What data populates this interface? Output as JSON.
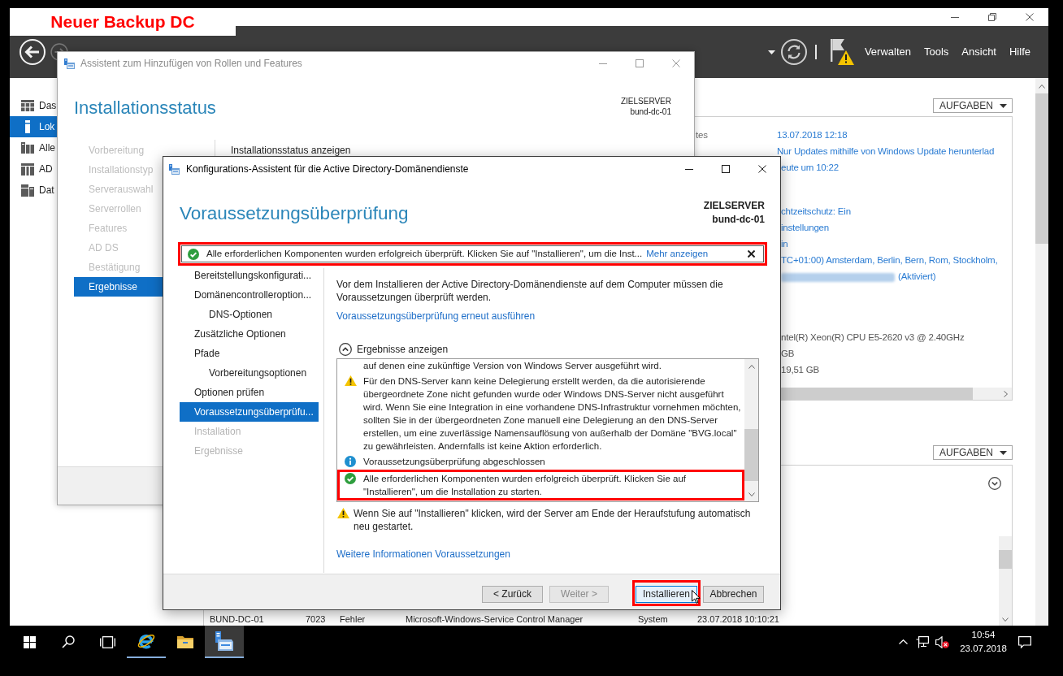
{
  "annotation": {
    "text": "Neuer Backup DC"
  },
  "server_manager": {
    "menu": [
      {
        "label": "Verwalten"
      },
      {
        "label": "Tools"
      },
      {
        "label": "Ansicht"
      },
      {
        "label": "Hilfe"
      }
    ],
    "sidebar": [
      {
        "label": "Das",
        "selected": false
      },
      {
        "label": "Lok",
        "selected": true
      },
      {
        "label": "Alle",
        "selected": false
      },
      {
        "label": "AD",
        "selected": false
      },
      {
        "label": "Dat",
        "selected": false
      }
    ],
    "properties": {
      "tasks_button": "AUFGABEN",
      "groups": [
        {
          "rows": [
            {
              "label": "tes",
              "value": "13.07.2018 12:18",
              "kind": "link"
            },
            {
              "value": "Nur Updates mithilfe von Windows Update herunterlad",
              "kind": "link"
            },
            {
              "value": "eute um 10:22",
              "kind": "link"
            }
          ]
        },
        {
          "rows": [
            {
              "value": "chtzeitschutz: Ein",
              "kind": "link"
            },
            {
              "value": "instellungen",
              "kind": "link"
            },
            {
              "value": "in",
              "kind": "link"
            },
            {
              "value": "TC+01:00) Amsterdam, Berlin, Bern, Rom, Stockholm,",
              "kind": "link"
            },
            {
              "value": "(Aktiviert)",
              "kind": "redacted"
            }
          ]
        },
        {
          "rows": [
            {
              "value": "ntel(R) Xeon(R) CPU E5-2620 v3 @ 2.40GHz",
              "kind": "text"
            },
            {
              "value": "GB",
              "kind": "text"
            },
            {
              "value": "19,51 GB",
              "kind": "text"
            }
          ]
        }
      ]
    },
    "events": {
      "tasks_button": "AUFGABEN",
      "rows": [
        {
          "cells": [
            "BUND-DC-01",
            "7023",
            "Fehler",
            "Microsoft-Windows-Service Control Manager",
            "System",
            "23.07.2018 10:10:21"
          ]
        }
      ]
    }
  },
  "roles_wizard": {
    "title": "Assistent zum Hinzufügen von Rollen und Features",
    "heading": "Installationsstatus",
    "target_label": "ZIELSERVER",
    "target_server": "bund-dc-01",
    "steps": [
      {
        "label": "Vorbereitung",
        "selected": false,
        "disabled": true
      },
      {
        "label": "Installationstyp",
        "selected": false,
        "disabled": true
      },
      {
        "label": "Serverauswahl",
        "selected": false,
        "disabled": true
      },
      {
        "label": "Serverrollen",
        "selected": false,
        "disabled": true
      },
      {
        "label": "Features",
        "selected": false,
        "disabled": true
      },
      {
        "label": "AD DS",
        "selected": false,
        "disabled": true
      },
      {
        "label": "Bestätigung",
        "selected": false,
        "disabled": true
      },
      {
        "label": "Ergebnisse",
        "selected": true,
        "disabled": false
      }
    ],
    "section_title": "Installationsstatus anzeigen"
  },
  "adds_wizard": {
    "title": "Konfigurations-Assistent für die Active Directory-Domänendienste",
    "heading": "Voraussetzungsüberprüfung",
    "target_label": "ZIELSERVER",
    "target_server": "bund-dc-01",
    "notification": {
      "text": "Alle erforderlichen Komponenten wurden erfolgreich überprüft. Klicken Sie auf \"Installieren\", um die Inst...",
      "link": "Mehr anzeigen",
      "highlighted": true
    },
    "steps": [
      {
        "label": "Bereitstellungskonfigurati...",
        "selected": false,
        "disabled": false
      },
      {
        "label": "Domänencontrolleroption...",
        "selected": false,
        "disabled": false,
        "children": [
          {
            "label": "DNS-Optionen",
            "selected": false,
            "disabled": false
          }
        ]
      },
      {
        "label": "Zusätzliche Optionen",
        "selected": false,
        "disabled": false
      },
      {
        "label": "Pfade",
        "selected": false,
        "disabled": false,
        "children": [
          {
            "label": "Vorbereitungsoptionen",
            "selected": false,
            "disabled": false
          }
        ]
      },
      {
        "label": "Optionen prüfen",
        "selected": false,
        "disabled": false
      },
      {
        "label": "Voraussetzungsüberprüfu...",
        "selected": true,
        "disabled": false
      },
      {
        "label": "Installation",
        "selected": false,
        "disabled": true
      },
      {
        "label": "Ergebnisse",
        "selected": false,
        "disabled": true
      }
    ],
    "intro": "Vor dem Installieren der Active Directory-Domänendienste auf dem Computer müssen die Voraussetzungen überprüft werden.",
    "rerun_link": "Voraussetzungsüberprüfung erneut ausführen",
    "results_toggle": {
      "label": "Ergebnisse anzeigen",
      "expanded": true
    },
    "results": [
      {
        "kind": "text",
        "text": "auf denen eine zukünftige Version von Windows Server ausgeführt wird.",
        "highlighted": false
      },
      {
        "kind": "warning",
        "text": "Für den DNS-Server kann keine Delegierung erstellt werden, da die autorisierende übergeordnete Zone nicht gefunden wurde oder Windows DNS-Server nicht ausgeführt wird. Wenn Sie eine Integration in eine vorhandene DNS-Infrastruktur vornehmen möchten, sollten Sie in der übergeordneten Zone manuell eine Delegierung an den DNS-Server erstellen, um eine zuverlässige Namensauflösung von außerhalb der Domäne \"BVG.local\" zu gewährleisten. Andernfalls ist keine Aktion erforderlich.",
        "highlighted": false
      },
      {
        "kind": "info",
        "text": "Voraussetzungsüberprüfung abgeschlossen",
        "highlighted": false
      },
      {
        "kind": "success",
        "text": "Alle erforderlichen Komponenten wurden erfolgreich überprüft. Klicken Sie auf \"Installieren\", um die Installation zu starten.",
        "highlighted": true
      }
    ],
    "restart_note": "Wenn Sie auf \"Installieren\" klicken, wird der Server am Ende der Heraufstufung automatisch neu gestartet.",
    "more_info_link": "Weitere Informationen Voraussetzungen",
    "buttons": [
      {
        "label": "< Zurück",
        "disabled": false,
        "hovered": false,
        "highlighted": false
      },
      {
        "label": "Weiter >",
        "disabled": true,
        "hovered": false,
        "highlighted": false
      },
      {
        "label": "Installieren",
        "disabled": false,
        "hovered": true,
        "highlighted": true
      },
      {
        "label": "Abbrechen",
        "disabled": false,
        "hovered": false,
        "highlighted": false
      }
    ]
  },
  "taskbar": {
    "apps": [
      {
        "kind": "browser",
        "running": true,
        "selected": false
      },
      {
        "kind": "file_explorer",
        "running": false,
        "selected": false
      },
      {
        "kind": "server_manager",
        "running": true,
        "selected": true
      }
    ],
    "time": "10:54",
    "date": "23.07.2018"
  }
}
